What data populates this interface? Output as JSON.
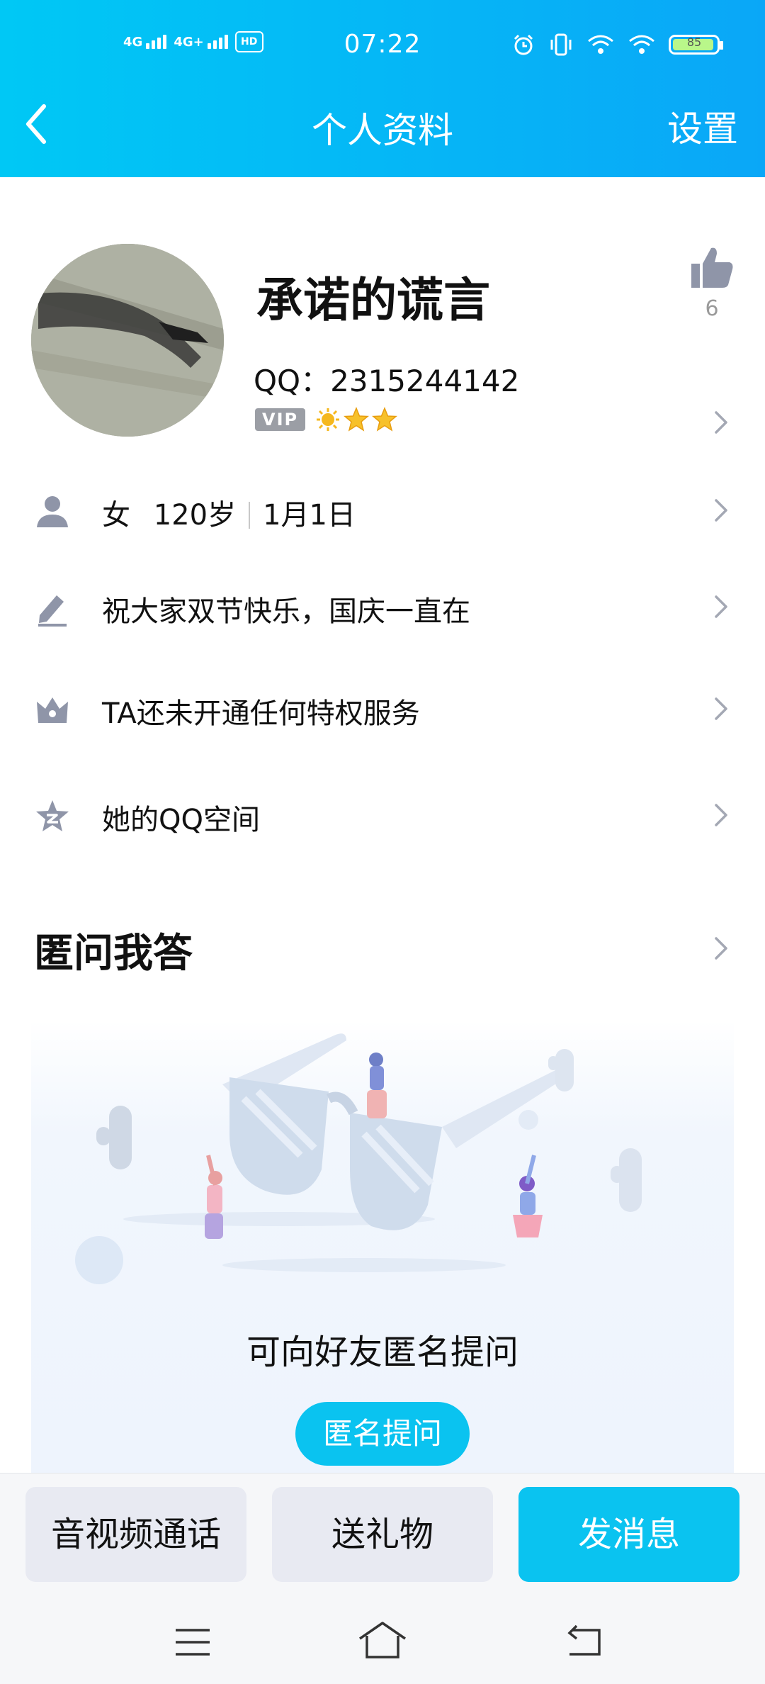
{
  "status_bar": {
    "left_signals": [
      "4G",
      "4G+"
    ],
    "hd_label": "HD",
    "time": "07:22",
    "battery_level": "85",
    "icons": [
      "alarm-icon",
      "vibrate-icon",
      "wifi-plus-icon",
      "wifi-icon",
      "battery-icon"
    ]
  },
  "header": {
    "title": "个人资料",
    "settings_label": "设置",
    "back_icon": "chevron-left-icon"
  },
  "profile": {
    "nickname": "承诺的谎言",
    "qq_line": "QQ：2315244142",
    "vip_label": "VIP",
    "like_count": "6"
  },
  "info_rows": [
    {
      "icon": "person-icon",
      "gender": "女",
      "age": "120岁",
      "birthday": "1月1日"
    },
    {
      "icon": "pencil-icon",
      "text": "祝大家双节快乐，国庆一直在"
    },
    {
      "icon": "crown-icon",
      "text": "TA还未开通任何特权服务"
    },
    {
      "icon": "qzone-star-icon",
      "text": "她的QQ空间"
    }
  ],
  "anonymous_section": {
    "title": "匿问我答",
    "prompt": "可向好友匿名提问",
    "button_label": "匿名提问"
  },
  "actions": {
    "call_label": "音视频通话",
    "gift_label": "送礼物",
    "message_label": "发消息"
  },
  "colors": {
    "header_start": "#00c8f5",
    "header_end": "#0aa7f7",
    "accent": "#0ac3f0",
    "secondary_button": "#e8eaf2",
    "icon_gray": "#8f95a8"
  },
  "system_nav": [
    "menu-icon",
    "home-icon",
    "back-icon"
  ]
}
